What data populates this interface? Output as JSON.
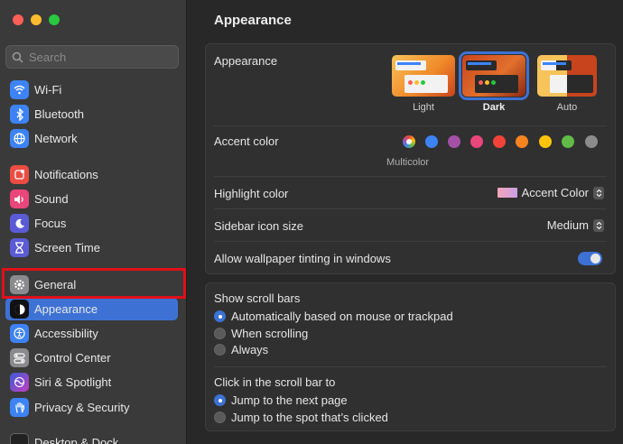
{
  "sidebar": {
    "search_placeholder": "Search",
    "items": [
      {
        "label": "Wi-Fi",
        "icon": "wifi-icon",
        "color": "#3d83f6"
      },
      {
        "label": "Bluetooth",
        "icon": "bluetooth-icon",
        "color": "#3d83f6"
      },
      {
        "label": "Network",
        "icon": "globe-icon",
        "color": "#3d83f6"
      },
      {
        "label": "Notifications",
        "icon": "bell-icon",
        "color": "#ea4d43"
      },
      {
        "label": "Sound",
        "icon": "speaker-icon",
        "color": "#e9467c"
      },
      {
        "label": "Focus",
        "icon": "moon-icon",
        "color": "#5c5bd6"
      },
      {
        "label": "Screen Time",
        "icon": "hourglass-icon",
        "color": "#5c5bd6"
      },
      {
        "label": "General",
        "icon": "gear-icon",
        "color": "#8b8b8f"
      },
      {
        "label": "Appearance",
        "icon": "appearance-icon",
        "color": "#111111"
      },
      {
        "label": "Accessibility",
        "icon": "accessibility-icon",
        "color": "#3d83f6"
      },
      {
        "label": "Control Center",
        "icon": "control-center-icon",
        "color": "#8b8b8f"
      },
      {
        "label": "Siri & Spotlight",
        "icon": "siri-icon",
        "color": "#b04cd8"
      },
      {
        "label": "Privacy & Security",
        "icon": "hand-icon",
        "color": "#3d83f6"
      },
      {
        "label": "Desktop & Dock",
        "icon": "dock-icon",
        "color": "#222222"
      }
    ]
  },
  "main": {
    "title": "Appearance",
    "appearance": {
      "label": "Appearance",
      "options": [
        "Light",
        "Dark",
        "Auto"
      ],
      "selected": "Dark"
    },
    "accent": {
      "label": "Accent color",
      "caption": "Multicolor",
      "colors": [
        "#multicolor",
        "#3d83f6",
        "#a550a7",
        "#e9467c",
        "#f1433a",
        "#f88420",
        "#fec40b",
        "#63ba47",
        "#8c8c8c"
      ]
    },
    "highlight": {
      "label": "Highlight color",
      "value": "Accent Color"
    },
    "sidebar_icon": {
      "label": "Sidebar icon size",
      "value": "Medium"
    },
    "tinting": {
      "label": "Allow wallpaper tinting in windows",
      "enabled": true
    },
    "scroll_bars": {
      "label": "Show scroll bars",
      "options": [
        "Automatically based on mouse or trackpad",
        "When scrolling",
        "Always"
      ],
      "selected": 0
    },
    "click_scroll": {
      "label": "Click in the scroll bar to",
      "options": [
        "Jump to the next page",
        "Jump to the spot that’s clicked"
      ],
      "selected": 0
    }
  }
}
